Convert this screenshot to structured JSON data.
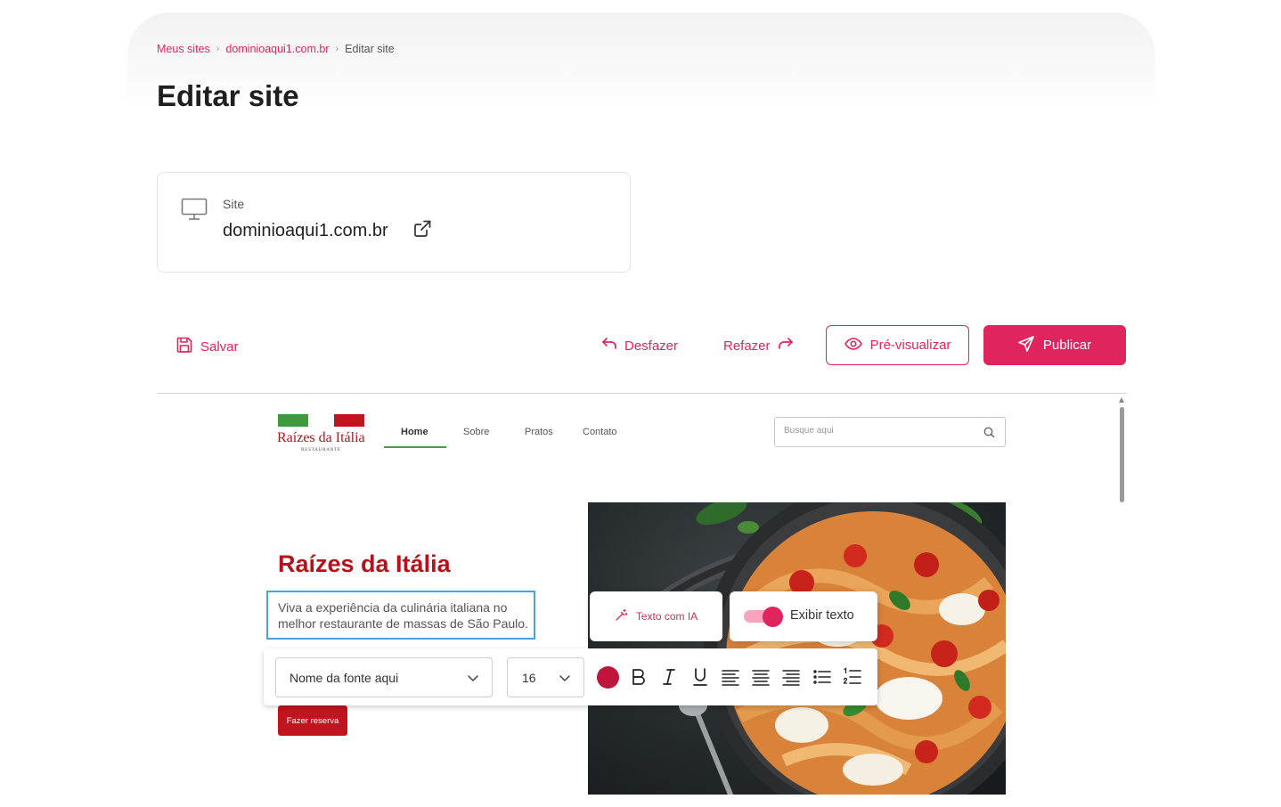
{
  "breadcrumb": {
    "items": [
      "Meus sites",
      "dominioaqui1.com.br"
    ],
    "current": "Editar site"
  },
  "page": {
    "title": "Editar site"
  },
  "site_card": {
    "label": "Site",
    "domain": "dominioaqui1.com.br"
  },
  "toolbar": {
    "save_label": "Salvar",
    "undo_label": "Desfazer",
    "redo_label": "Refazer",
    "preview_label": "Pré-visualizar",
    "publish_label": "Publicar"
  },
  "preview_site": {
    "logo_text": "Raízes da Itália",
    "logo_subtext": "RESTAURANTE",
    "nav": [
      "Home",
      "Sobre",
      "Pratos",
      "Contato"
    ],
    "active_nav": "Home",
    "search_placeholder": "Busque aqui",
    "hero_title": "Raízes da Itália",
    "hero_text": "Viva a experiência da culinária italiana no melhor restaurante de massas de São Paulo.",
    "cta_label": "Fazer reserva"
  },
  "editor_popover": {
    "ai_label": "Texto com IA",
    "toggle_label": "Exibir texto",
    "toggle_on": true,
    "font_name": "Nome da fonte aqui",
    "font_size": "16",
    "text_color": "#c0143c"
  },
  "colors": {
    "accent": "#e0245e",
    "site_red": "#b5121c",
    "site_green": "#43a047",
    "selection_blue": "#4ba3d9"
  },
  "icons": {
    "save": "floppy-disk-icon",
    "undo": "undo-arrow-icon",
    "redo": "redo-arrow-icon",
    "preview": "eye-icon",
    "publish": "paper-plane-icon",
    "site": "monitor-icon",
    "external": "external-link-icon",
    "ai": "magic-wand-icon"
  }
}
